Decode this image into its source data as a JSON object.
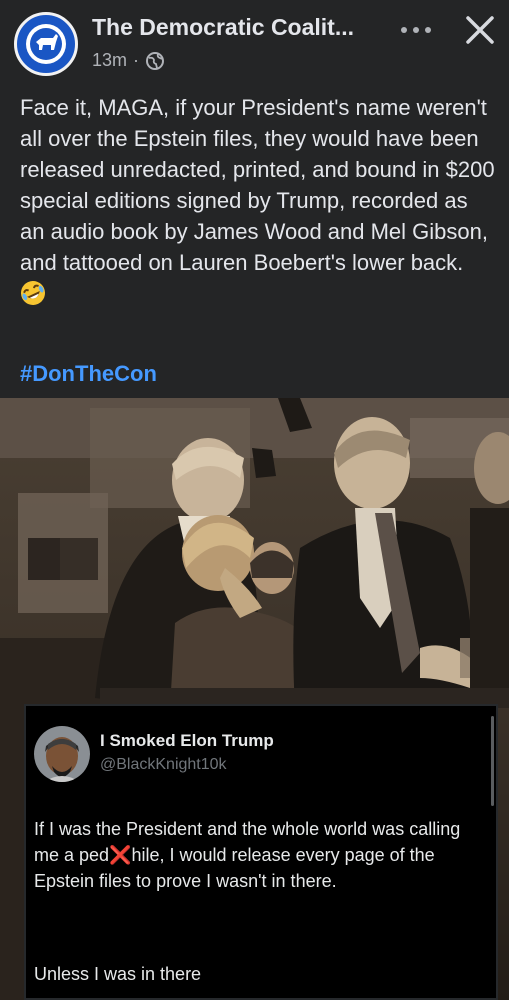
{
  "header": {
    "page_name": "The Democratic Coalit...",
    "timestamp": "13m",
    "separator": "·",
    "privacy_icon": "globe-icon",
    "more_icon": "more-dots-icon",
    "close_icon": "close-icon"
  },
  "post": {
    "text": "Face it, MAGA, if your President's name weren't all over the Epstein files, they would have been released unredacted, printed, and bound in $200 special editions signed by Trump, recorded as an audio book by James Wood and Mel Gibson, and tattooed on Lauren Boebert's lower back.",
    "emoji": "rolling-laughing-emoji",
    "hashtag": "#DonTheCon"
  },
  "embedded_tweet": {
    "name": "I Smoked Elon Trump",
    "handle": "@BlackKnight10k",
    "text_before": "If I was the President and the whole world was calling me a ped",
    "censor_mark": "❌",
    "text_after": "hile, I would release every page of the Epstein files to prove I wasn't in there.",
    "closing_line": "Unless I was in there"
  },
  "colors": {
    "background": "#242526",
    "text": "#e4e6eb",
    "secondary_text": "#b0b3b8",
    "hashtag": "#4599ff",
    "tweet_background": "#000000"
  }
}
